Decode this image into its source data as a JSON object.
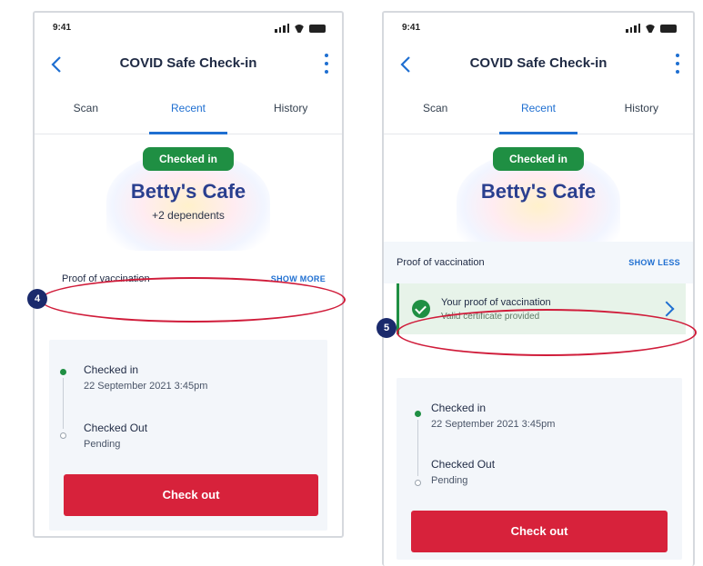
{
  "status_bar": {
    "time": "9:41"
  },
  "app": {
    "title": "COVID Safe Check-in",
    "tabs": [
      {
        "label": "Scan",
        "active": false
      },
      {
        "label": "Recent",
        "active": true
      },
      {
        "label": "History",
        "active": false
      }
    ]
  },
  "checkin": {
    "badge": "Checked in",
    "venue": "Betty's Cafe",
    "dependents": "+2 dependents"
  },
  "vaccination": {
    "label": "Proof of vaccination",
    "show_more": "SHOW MORE",
    "show_less": "SHOW LESS",
    "proof_title": "Your proof of vaccination",
    "proof_subtitle": "Valid certificate provided"
  },
  "timeline": {
    "checked_in_title": "Checked in",
    "checked_in_time": "22 September 2021 3:45pm",
    "checked_out_title": "Checked Out",
    "checked_out_status": "Pending"
  },
  "checkout_button": "Check out",
  "steps": {
    "left": "4",
    "right": "5"
  },
  "colors": {
    "accent_blue": "#1f6fd1",
    "success_green": "#1f8f43",
    "checkout_red": "#d7223b",
    "callout_red": "#d01c3a",
    "step_marker_navy": "#1a2a6c"
  }
}
